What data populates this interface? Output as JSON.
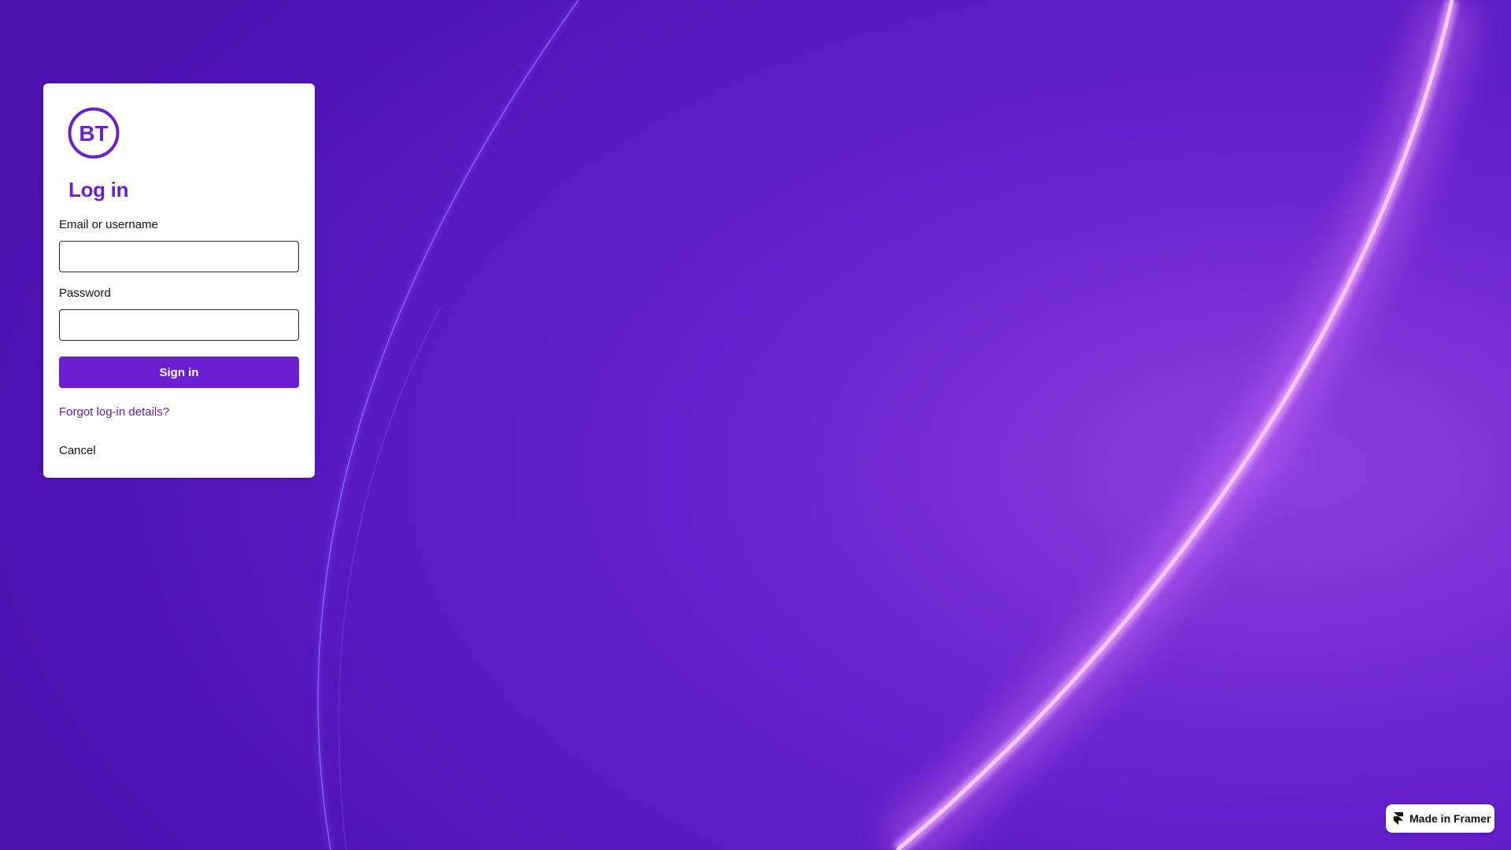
{
  "brand": {
    "logo_text": "BT",
    "accent_color": "#6b20c9",
    "button_color": "#6b1dd1",
    "background_color": "#4f12b8"
  },
  "login": {
    "title": "Log in",
    "email_label": "Email or username",
    "email_value": "",
    "password_label": "Password",
    "password_value": "",
    "sign_in_label": "Sign in",
    "forgot_label": "Forgot log-in details?",
    "cancel_label": "Cancel"
  },
  "badge": {
    "label": "Made in Framer",
    "icon": "framer-icon"
  }
}
